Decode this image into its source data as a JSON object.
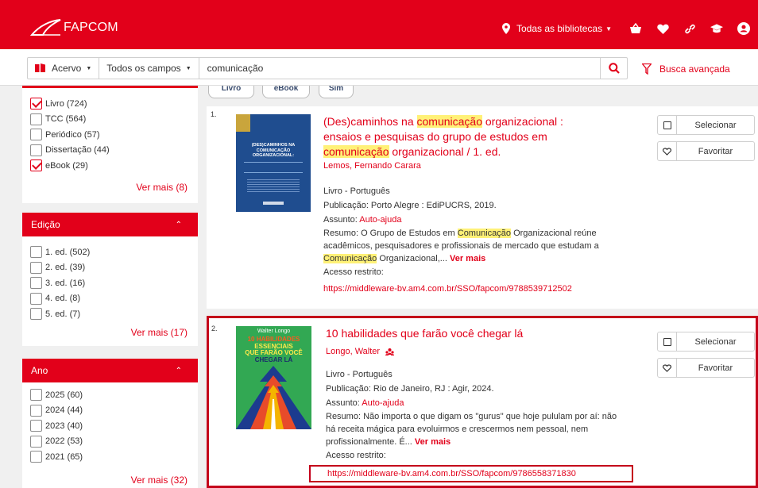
{
  "header": {
    "brand": "FAPCOM",
    "library_selector": "Todas as bibliotecas",
    "icons": [
      "basket-icon",
      "heart-icon",
      "link-icon",
      "graduation-cap-icon",
      "user-icon"
    ],
    "colors": {
      "primary": "#e2001a",
      "highlight": "#fff177"
    }
  },
  "search": {
    "collection": "Acervo",
    "field": "Todos os campos",
    "query": "comunicação",
    "advanced_label": "Busca avançada"
  },
  "chips": [
    "Livro",
    "eBook",
    "Sim"
  ],
  "facets": {
    "tipo": {
      "items": [
        {
          "label": "Livro (724)",
          "checked": true
        },
        {
          "label": "TCC (564)",
          "checked": false
        },
        {
          "label": "Periódico (57)",
          "checked": false
        },
        {
          "label": "Dissertação (44)",
          "checked": false
        },
        {
          "label": "eBook (29)",
          "checked": true
        }
      ],
      "more": "Ver mais (8)"
    },
    "edicao": {
      "title": "Edição",
      "items": [
        "1. ed. (502)",
        "2. ed. (39)",
        "3. ed. (16)",
        "4. ed. (8)",
        "5. ed. (7)"
      ],
      "more": "Ver mais (17)"
    },
    "ano": {
      "title": "Ano",
      "items": [
        "2025 (60)",
        "2024 (44)",
        "2023 (40)",
        "2022 (53)",
        "2021 (65)"
      ],
      "more": "Ver mais (32)"
    }
  },
  "actions": {
    "select": "Selecionar",
    "favorite": "Favoritar"
  },
  "results": [
    {
      "number": "1.",
      "title_parts": [
        "(Des)caminhos na ",
        "comunicação",
        " organizacional :",
        "ensaios e pesquisas do grupo de estudos em",
        "comunicação",
        " organizacional / 1. ed."
      ],
      "author": "Lemos, Fernando Carara",
      "type_lang": "Livro - Português",
      "publication": "Publicação: Porto Alegre : EdiPUCRS, 2019.",
      "subject_label": "Assunto:",
      "subject": "Auto-ajuda",
      "summary_parts": [
        "Resumo: O Grupo de Estudos em ",
        "Comunicação",
        " Organizacional reúne",
        "acadêmicos, pesquisadores e profissionais de mercado que estudam a",
        "Comunicação",
        " Organizacional,... "
      ],
      "more": "Ver mais",
      "access": "Acesso restrito:",
      "url": "https://middleware-bv.am4.com.br/SSO/fapcom/9788539712502",
      "cover_text": "(DES)CAMINHOS NA COMUNICAÇÃO ORGANIZACIONAL:"
    },
    {
      "number": "2.",
      "title": "10 habilidades que farão você chegar lá",
      "author": "Longo, Walter",
      "type_lang": "Livro - Português",
      "publication": "Publicação: Rio de Janeiro, RJ : Agir, 2024.",
      "subject_label": "Assunto:",
      "subject": "Auto-ajuda",
      "summary_lines": [
        "Resumo: Não importa o que digam os \"gurus\" que hoje pululam por aí: não",
        "há receita mágica para evoluirmos e crescermos nem pessoal, nem",
        "profissionalmente. É... "
      ],
      "more": "Ver mais",
      "access": "Acesso restrito:",
      "url": "https://middleware-bv.am4.com.br/SSO/fapcom/9786558371830",
      "cover_author": "Walter Longo",
      "cover_title": [
        "10 HABILIDADES",
        "ESSENCIAIS",
        "QUE FARÃO VOCÊ",
        "CHEGAR LÁ"
      ]
    }
  ]
}
